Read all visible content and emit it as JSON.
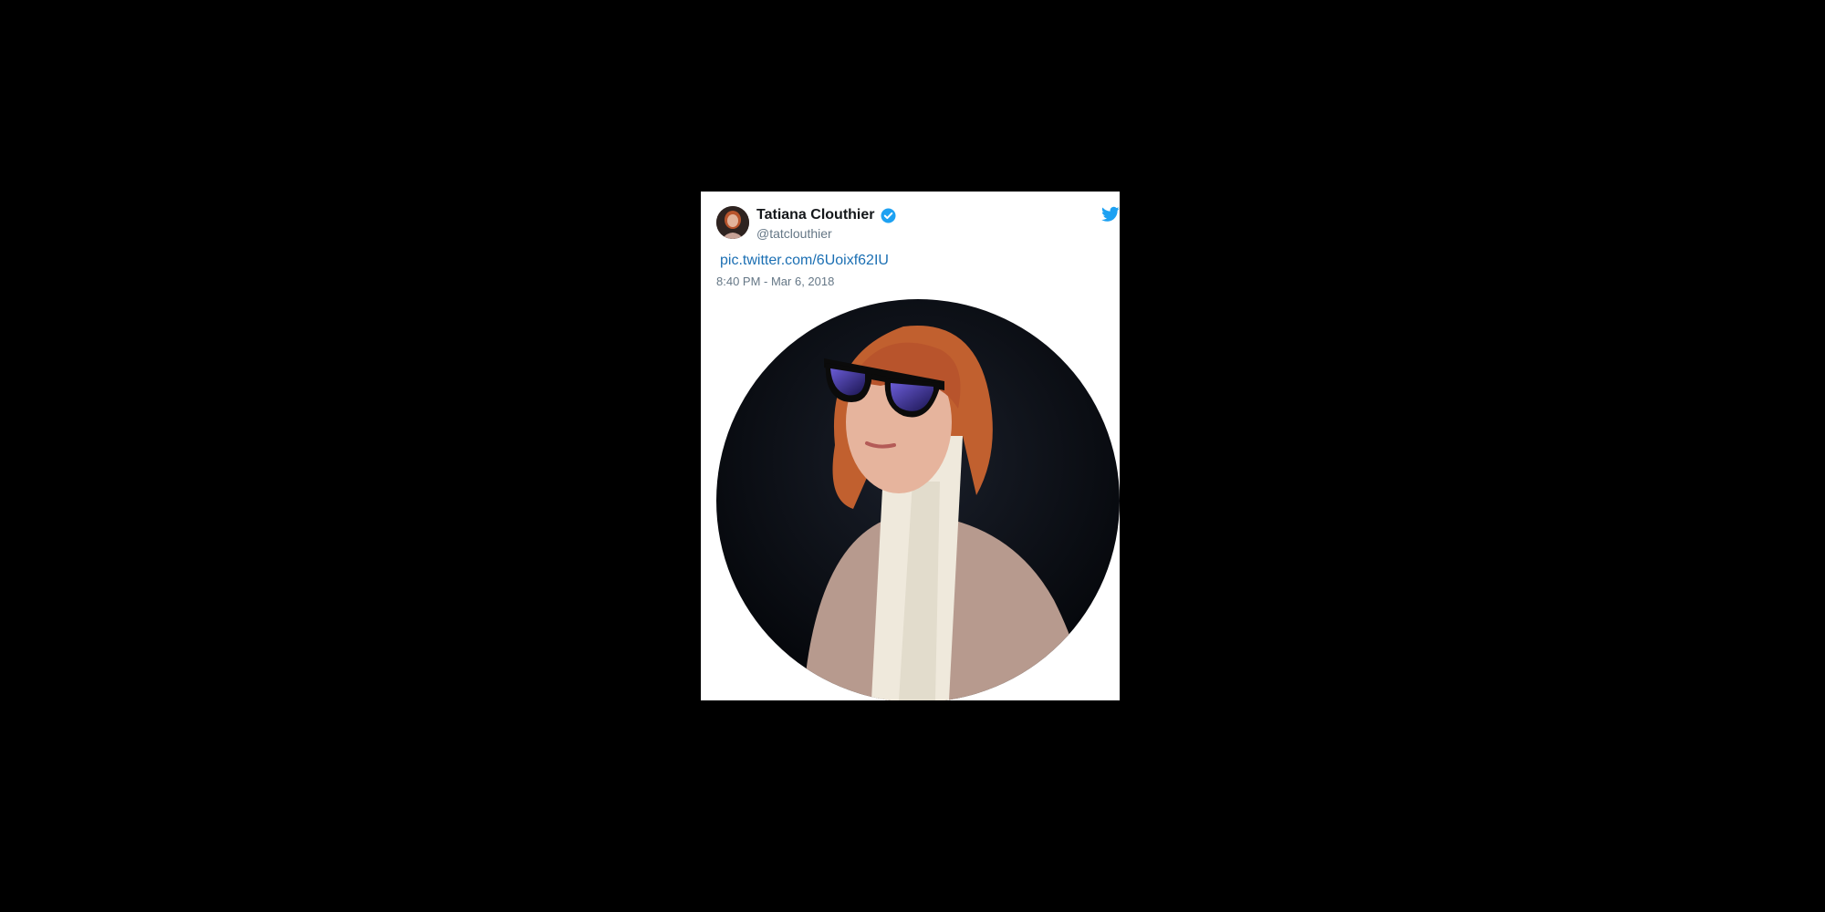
{
  "tweet": {
    "display_name": "Tatiana Clouthier",
    "handle": "@tatclouthier",
    "link_text": "pic.twitter.com/6Uoixf62IU",
    "timestamp": "8:40 PM - Mar 6, 2018",
    "verified": true
  },
  "icons": {
    "verified": "verified-badge-icon",
    "brand": "twitter-bird-icon"
  },
  "colors": {
    "page_background": "#000000",
    "card_background": "#ffffff",
    "name": "#14171a",
    "handle": "#657786",
    "link": "#1b6fb3",
    "twitter_blue": "#1da1f2"
  }
}
